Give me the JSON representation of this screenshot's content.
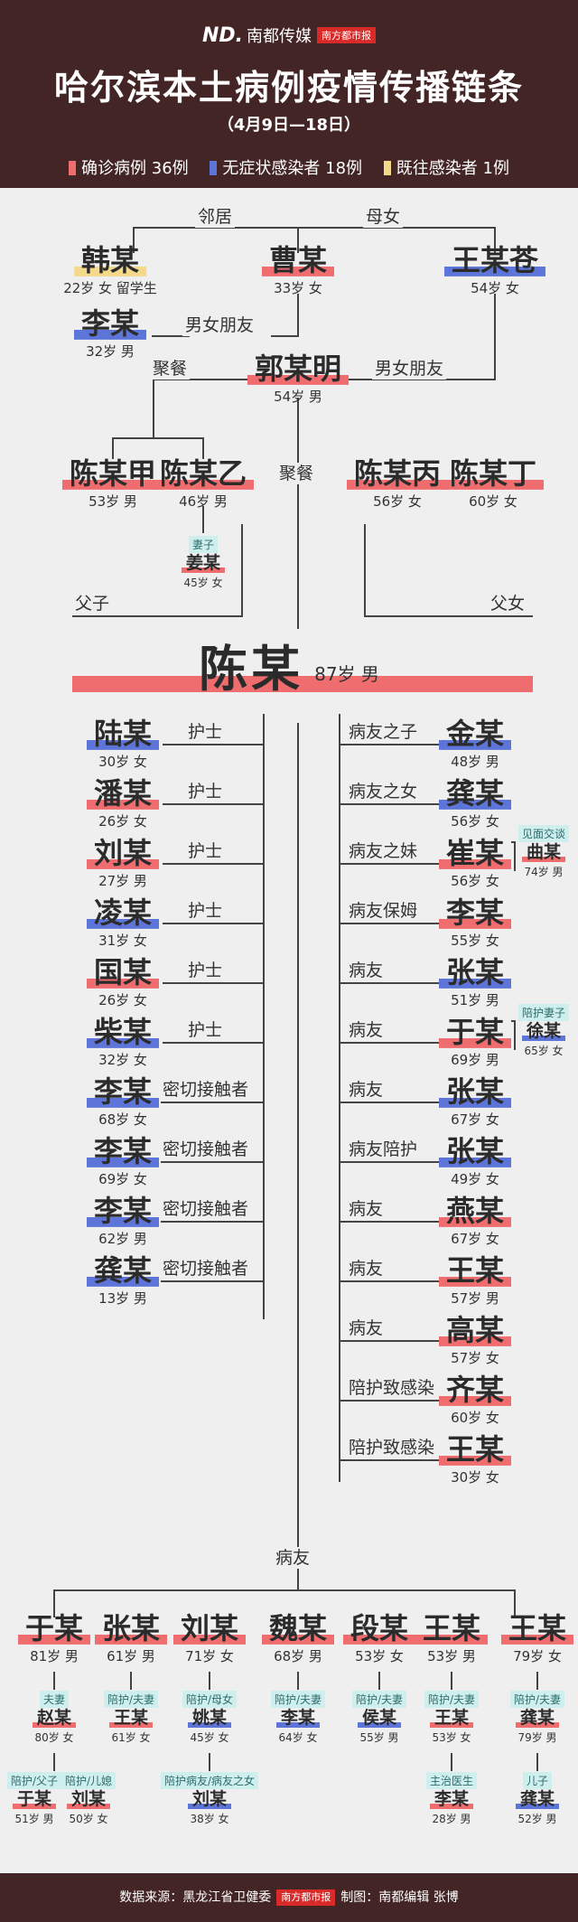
{
  "header": {
    "brand": "南都传媒",
    "title": "哈尔滨本土病例疫情传播链条",
    "subtitle": "（4月9日—18日）",
    "legend": [
      {
        "label": "确诊病例 36例",
        "color": "#ef6d6f"
      },
      {
        "label": "无症状感染者 18例",
        "color": "#5d75d8"
      },
      {
        "label": "既往感染者 1例",
        "color": "#f4d98a"
      }
    ]
  },
  "colors": {
    "confirmed": "#ef6d6f",
    "asymptomatic": "#5d75d8",
    "previous": "#f4d98a",
    "header_bg": "#432525"
  },
  "relations": {
    "neighbor": "邻居",
    "mother_daughter": "母女",
    "boyfriend_girlfriend": "男女朋友",
    "dinner": "聚餐",
    "wife": "妻子",
    "father_son": "父子",
    "father_daughter": "父女",
    "nurse": "护士",
    "close_contact": "密切接触者",
    "patients_friend": "病友",
    "friends_son": "病友之子",
    "friends_daughter": "病友之女",
    "friends_sister": "病友之妹",
    "friends_nanny": "病友保姆",
    "friends_escort": "病友陪护",
    "escort_infected": "陪护致感染",
    "bottom_friends": "病友"
  },
  "upper": {
    "han": {
      "name": "韩某",
      "info": "22岁 女 留学生",
      "status": "x"
    },
    "cao": {
      "name": "曹某",
      "info": "33岁 女",
      "status": "c"
    },
    "wang": {
      "name": "王某苍",
      "info": "54岁 女",
      "status": "a"
    },
    "li": {
      "name": "李某",
      "info": "32岁 男",
      "status": "a"
    },
    "guo": {
      "name": "郭某明",
      "info": "54岁 男",
      "status": "c"
    },
    "chen_a": {
      "name": "陈某甲",
      "info": "53岁 男",
      "status": "c"
    },
    "chen_b": {
      "name": "陈某乙",
      "info": "46岁 男",
      "status": "c"
    },
    "chen_c": {
      "name": "陈某丙",
      "info": "56岁 女",
      "status": "c"
    },
    "chen_d": {
      "name": "陈某丁",
      "info": "60岁 女",
      "status": "c"
    },
    "jiang": {
      "name": "姜某",
      "info": "45岁 女",
      "status": "c"
    }
  },
  "center": {
    "name": "陈某",
    "info": "87岁 男",
    "status": "c"
  },
  "left": [
    {
      "name": "陆某",
      "info": "30岁 女",
      "status": "a",
      "rel": "nurse"
    },
    {
      "name": "潘某",
      "info": "26岁 女",
      "status": "c",
      "rel": "nurse"
    },
    {
      "name": "刘某",
      "info": "27岁 男",
      "status": "c",
      "rel": "nurse"
    },
    {
      "name": "凌某",
      "info": "31岁 女",
      "status": "a",
      "rel": "nurse"
    },
    {
      "name": "国某",
      "info": "26岁 女",
      "status": "c",
      "rel": "nurse"
    },
    {
      "name": "柴某",
      "info": "32岁 女",
      "status": "a",
      "rel": "nurse"
    },
    {
      "name": "李某",
      "info": "68岁 女",
      "status": "a",
      "rel": "close_contact"
    },
    {
      "name": "李某",
      "info": "69岁 女",
      "status": "a",
      "rel": "close_contact"
    },
    {
      "name": "李某",
      "info": "62岁 男",
      "status": "a",
      "rel": "close_contact"
    },
    {
      "name": "龚某",
      "info": "13岁 男",
      "status": "a",
      "rel": "close_contact"
    }
  ],
  "right": [
    {
      "name": "金某",
      "info": "48岁 男",
      "status": "a",
      "rel": "friends_son"
    },
    {
      "name": "龚某",
      "info": "56岁 女",
      "status": "a",
      "rel": "friends_daughter"
    },
    {
      "name": "崔某",
      "info": "56岁 女",
      "status": "c",
      "rel": "friends_sister"
    },
    {
      "name": "李某",
      "info": "55岁 女",
      "status": "c",
      "rel": "friends_nanny"
    },
    {
      "name": "张某",
      "info": "51岁 男",
      "status": "a",
      "rel": "patients_friend"
    },
    {
      "name": "于某",
      "info": "69岁 男",
      "status": "c",
      "rel": "patients_friend"
    },
    {
      "name": "张某",
      "info": "67岁 女",
      "status": "a",
      "rel": "patients_friend"
    },
    {
      "name": "张某",
      "info": "49岁 女",
      "status": "a",
      "rel": "friends_escort"
    },
    {
      "name": "燕某",
      "info": "67岁 女",
      "status": "c",
      "rel": "patients_friend"
    },
    {
      "name": "王某",
      "info": "57岁 男",
      "status": "c",
      "rel": "patients_friend"
    },
    {
      "name": "高某",
      "info": "57岁 女",
      "status": "c",
      "rel": "patients_friend"
    },
    {
      "name": "齐某",
      "info": "60岁 女",
      "status": "c",
      "rel": "escort_infected"
    },
    {
      "name": "王某",
      "info": "30岁 女",
      "status": "c",
      "rel": "escort_infected"
    }
  ],
  "side": [
    {
      "tag": "见面交谈",
      "name": "曲某",
      "info": "74岁 男",
      "status": "c"
    },
    {
      "tag": "陪护妻子",
      "name": "徐某",
      "info": "65岁 女",
      "status": "a"
    }
  ],
  "bottom": [
    {
      "name": "于某",
      "info": "81岁 男",
      "status": "c",
      "sub": [
        {
          "tag": "夫妻",
          "name": "赵某",
          "info": "80岁 女",
          "status": "c"
        }
      ],
      "sub2": [
        {
          "tag": "陪护/父子",
          "name": "于某",
          "info": "51岁 男",
          "status": "c"
        },
        {
          "tag": "陪护/儿媳",
          "name": "刘某",
          "info": "50岁 女",
          "status": "c"
        }
      ]
    },
    {
      "name": "张某",
      "info": "61岁 男",
      "status": "c",
      "sub": [
        {
          "tag": "陪护/夫妻",
          "name": "王某",
          "info": "61岁 女",
          "status": "c"
        }
      ]
    },
    {
      "name": "刘某",
      "info": "71岁 女",
      "status": "c",
      "sub": [
        {
          "tag": "陪护/母女",
          "name": "姚某",
          "info": "45岁 女",
          "status": "a"
        }
      ],
      "sub2": [
        {
          "tag": "陪护病友/病友之女",
          "name": "刘某",
          "info": "38岁 女",
          "status": "a"
        }
      ]
    },
    {
      "name": "魏某",
      "info": "68岁 男",
      "status": "c",
      "sub": [
        {
          "tag": "陪护/夫妻",
          "name": "李某",
          "info": "64岁 女",
          "status": "a"
        }
      ]
    },
    {
      "name": "段某",
      "info": "53岁 女",
      "status": "c",
      "sub": [
        {
          "tag": "陪护/夫妻",
          "name": "侯某",
          "info": "55岁 男",
          "status": "a"
        }
      ]
    },
    {
      "name": "王某",
      "info": "53岁 男",
      "status": "c",
      "sub": [
        {
          "tag": "陪护/夫妻",
          "name": "王某",
          "info": "53岁 女",
          "status": "c"
        }
      ],
      "sub2": [
        {
          "tag": "主治医生",
          "name": "李某",
          "info": "28岁 男",
          "status": "c"
        }
      ]
    },
    {
      "name": "王某",
      "info": "79岁 女",
      "status": "c",
      "sub": [
        {
          "tag": "陪护/夫妻",
          "name": "龚某",
          "info": "79岁 男",
          "status": "c"
        }
      ],
      "sub2": [
        {
          "tag": "儿子",
          "name": "龚某",
          "info": "52岁 男",
          "status": "a"
        }
      ]
    }
  ],
  "footer": {
    "source": "数据来源：黑龙江省卫健委",
    "brand": "南方都市报",
    "credit": "制图：南都编辑 张博"
  }
}
